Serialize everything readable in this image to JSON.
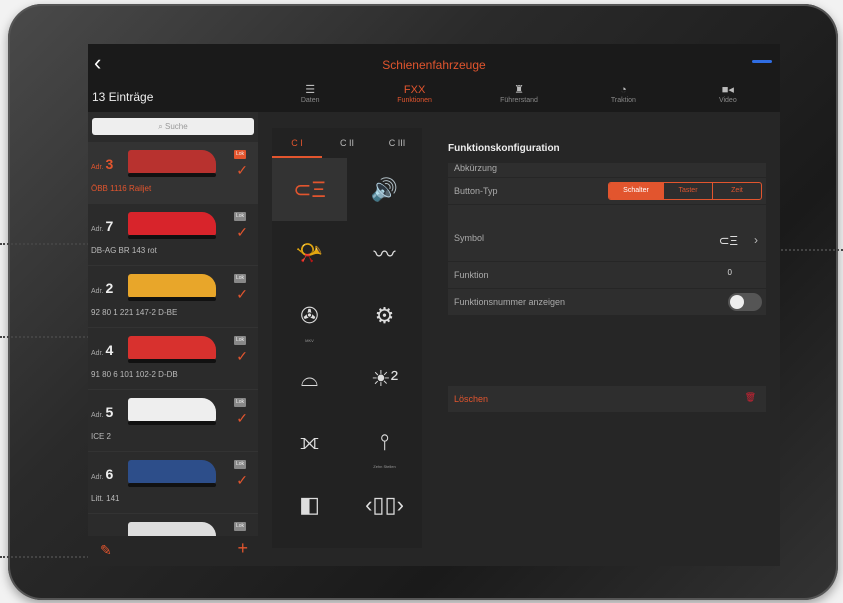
{
  "header": {
    "back_icon": "chevron-left-icon",
    "title": "Schienenfahrzeuge",
    "count_label": "13 Einträge",
    "tabs": [
      {
        "icon": "list-icon",
        "label": "Daten"
      },
      {
        "icon": "functions-icon",
        "label": "Funktionen",
        "glyph": "FXX"
      },
      {
        "icon": "cab-icon",
        "label": "Führerstand"
      },
      {
        "icon": "gauge-icon",
        "label": "Traktion"
      },
      {
        "icon": "video-icon",
        "label": "Video"
      }
    ],
    "active_tab": "Funktionen"
  },
  "sidebar": {
    "search_placeholder": "Suche",
    "items": [
      {
        "adr_prefix": "Adr.",
        "adr": "3",
        "desc": "ÖBB 1116 Railjet",
        "badge": "Lok",
        "color": "#b8322f"
      },
      {
        "adr_prefix": "Adr.",
        "adr": "7",
        "desc": "DB-AG BR 143 rot",
        "badge": "Lok",
        "color": "#d8242b"
      },
      {
        "adr_prefix": "Adr.",
        "adr": "2",
        "desc": "92 80 1 221 147-2 D-BE",
        "badge": "Lok",
        "color": "#e8a62a"
      },
      {
        "adr_prefix": "Adr.",
        "adr": "4",
        "desc": "91 80 6 101 102-2 D-DB",
        "badge": "Lok",
        "color": "#d8312e"
      },
      {
        "adr_prefix": "Adr.",
        "adr": "5",
        "desc": "ICE 2",
        "badge": "Lok",
        "color": "#eeeeee"
      },
      {
        "adr_prefix": "Adr.",
        "adr": "6",
        "desc": "Litt. 141",
        "badge": "Lok",
        "color": "#2d4e8a"
      },
      {
        "adr_prefix": "",
        "adr": "",
        "desc": "",
        "badge": "Lok",
        "color": "#dddddd"
      }
    ]
  },
  "functions": {
    "tabs": [
      "C I",
      "C II",
      "C III"
    ],
    "cells": [
      {
        "icon": "headlight-icon",
        "glyph": "⊂Ξ",
        "caption": ""
      },
      {
        "icon": "speaker-icon",
        "glyph": "🔊",
        "caption": ""
      },
      {
        "icon": "horn-icon",
        "glyph": "📯",
        "caption": ""
      },
      {
        "icon": "horn-sound-icon",
        "glyph": "〰",
        "caption": ""
      },
      {
        "icon": "fan-icon",
        "glyph": "✇",
        "caption": "MKV"
      },
      {
        "icon": "wheel-sound-icon",
        "glyph": "⚙",
        "caption": ""
      },
      {
        "icon": "conductor-cap-icon",
        "glyph": "⌓",
        "caption": ""
      },
      {
        "icon": "cab-light-2-icon",
        "glyph": "☀²",
        "caption": ""
      },
      {
        "icon": "coupling-icon",
        "glyph": "⟗",
        "caption": ""
      },
      {
        "icon": "signal-sound-icon",
        "glyph": "⫯",
        "caption": "Zehn Stellen"
      },
      {
        "icon": "door-icon",
        "glyph": "◧",
        "caption": ""
      },
      {
        "icon": "doors-sound-icon",
        "glyph": "‹▯▯›",
        "caption": ""
      }
    ]
  },
  "config": {
    "title": "Funktionskonfiguration",
    "abbr_label": "Abkürzung",
    "button_type_label": "Button-Typ",
    "button_type_options": [
      "Schalter",
      "Taster",
      "Zeit"
    ],
    "symbol_label": "Symbol",
    "symbol_icon": "headlight-icon",
    "function_label": "Funktion",
    "function_value": "0",
    "show_number_label": "Funktionsnummer anzeigen",
    "delete_label": "Löschen",
    "accent": "#e2552e"
  }
}
